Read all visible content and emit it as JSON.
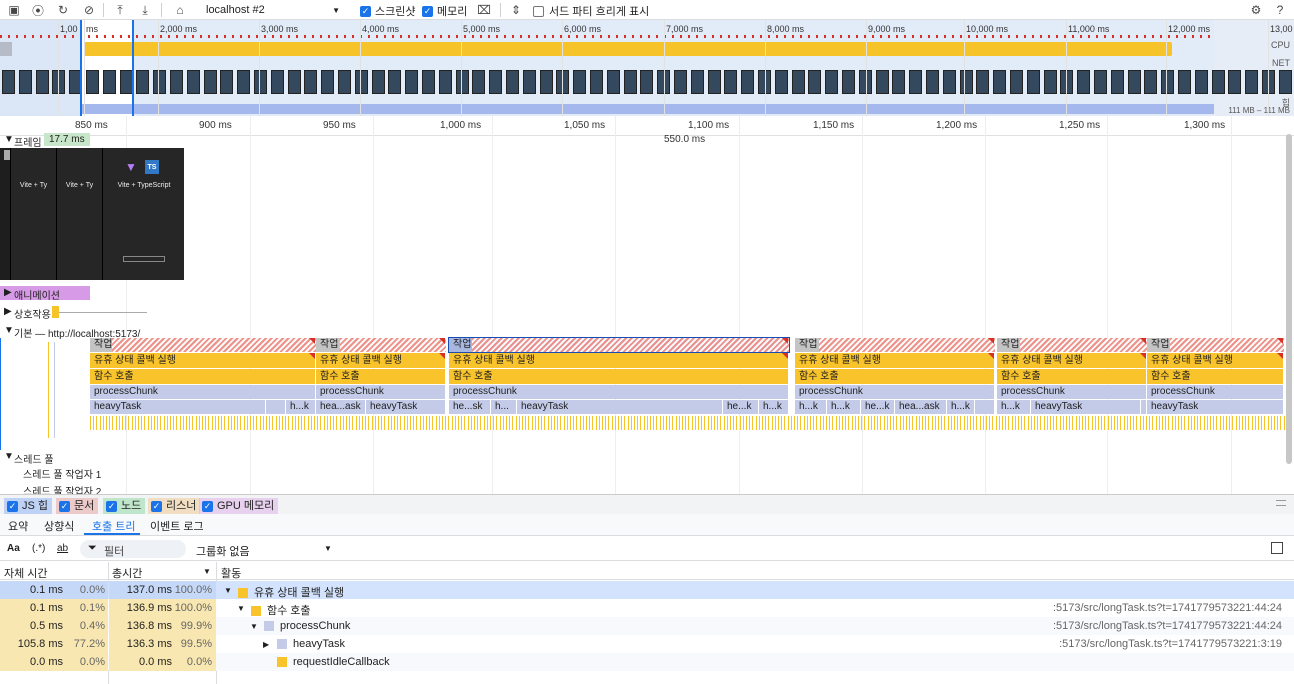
{
  "toolbar": {
    "url_select": "localhost #2",
    "screenshot_label": "스크린샷",
    "memory_label": "메모리",
    "third_party_label": "서드 파티 흐리게 표시"
  },
  "overview": {
    "ticks": [
      "1,00",
      "ms",
      "2,000 ms",
      "3,000 ms",
      "4,000 ms",
      "5,000 ms",
      "6,000 ms",
      "7,000 ms",
      "8,000 ms",
      "9,000 ms",
      "10,000 ms",
      "11,000 ms",
      "12,000 ms",
      "13,00"
    ],
    "cpu_label": "CPU",
    "net_label": "NET",
    "heap_label": "힙",
    "heap_range": "111 MB – 111 MB"
  },
  "ruler": {
    "labels": [
      "850 ms",
      "900 ms",
      "950 ms",
      "1,000 ms",
      "1,050 ms",
      "1,100 ms",
      "1,150 ms",
      "1,200 ms",
      "1,250 ms",
      "1,300 ms"
    ],
    "selection_duration": "550.0 ms"
  },
  "tracks": {
    "frames_label": "프레임",
    "frames_badge": "17.7 ms",
    "screenshot_title": "Vite + TypeScript",
    "screenshot_title_short": "Vite + Ty",
    "ts_badge": "TS",
    "animation_label": "애니메이션",
    "interaction_label": "상호작용",
    "main_label": "기본 — http://localhost:5173/",
    "thread_pool_label": "스레드 풀",
    "worker1_label": "스레드 풀 작업자 1",
    "worker2_label": "스레드 풀 작업자 2"
  },
  "flame": {
    "task_label": "작업",
    "idle_label": "유휴 상태 콜백 실행",
    "call_label": "함수 호출",
    "chunk_label": "processChunk",
    "heavy_labels": [
      "heavyTask",
      "h...k",
      "hea...ask",
      "heavyTask",
      "he...sk",
      "h...",
      "heavyTask",
      "he...k",
      "h...k",
      "h...k",
      "h...k",
      "he...k",
      "hea...ask",
      "h...k",
      "h...k",
      "heavyTask",
      "heavyTask"
    ]
  },
  "legend": {
    "items": [
      {
        "label": "JS 힙",
        "color": "#5b8ff9"
      },
      {
        "label": "문서",
        "color": "#e37777"
      },
      {
        "label": "노드",
        "color": "#5ecb7a"
      },
      {
        "label": "리스너",
        "color": "#f0b060"
      },
      {
        "label": "GPU 메모리",
        "color": "#d78ce6"
      }
    ]
  },
  "tabs": [
    "요약",
    "상향식",
    "호출 트리",
    "이벤트 로그"
  ],
  "active_tab": "호출 트리",
  "filter": {
    "aa": "Aa",
    "regex": "(.*)",
    "ab": "ab",
    "placeholder": "필터",
    "grouping": "그룹화 없음"
  },
  "table": {
    "col_self": "자체 시간",
    "col_total": "총시간",
    "col_activity": "활동",
    "rows": [
      {
        "self": "0.1 ms",
        "self_pct": "0.0%",
        "total": "137.0 ms",
        "total_pct": "100.0%",
        "name": "유휴 상태 콜백 실행",
        "url": "",
        "color": "#f9c32b",
        "expand": "▼",
        "indent": 0
      },
      {
        "self": "0.1 ms",
        "self_pct": "0.1%",
        "total": "136.9 ms",
        "total_pct": "100.0%",
        "name": "함수 호출",
        "url": ":5173/src/longTask.ts?t=1741779573221:44:24",
        "color": "#f9c32b",
        "expand": "▼",
        "indent": 1
      },
      {
        "self": "0.5 ms",
        "self_pct": "0.4%",
        "total": "136.8 ms",
        "total_pct": "99.9%",
        "name": "processChunk",
        "url": ":5173/src/longTask.ts?t=1741779573221:44:24",
        "color": "#c3cbe8",
        "expand": "▼",
        "indent": 2
      },
      {
        "self": "105.8 ms",
        "self_pct": "77.2%",
        "total": "136.3 ms",
        "total_pct": "99.5%",
        "name": "heavyTask",
        "url": ":5173/src/longTask.ts?t=1741779573221:3:19",
        "color": "#c3cbe8",
        "expand": "▶",
        "indent": 3
      },
      {
        "self": "0.0 ms",
        "self_pct": "0.0%",
        "total": "0.0 ms",
        "total_pct": "0.0%",
        "name": "requestIdleCallback",
        "url": "",
        "color": "#f9c32b",
        "expand": "",
        "indent": 3
      }
    ]
  }
}
